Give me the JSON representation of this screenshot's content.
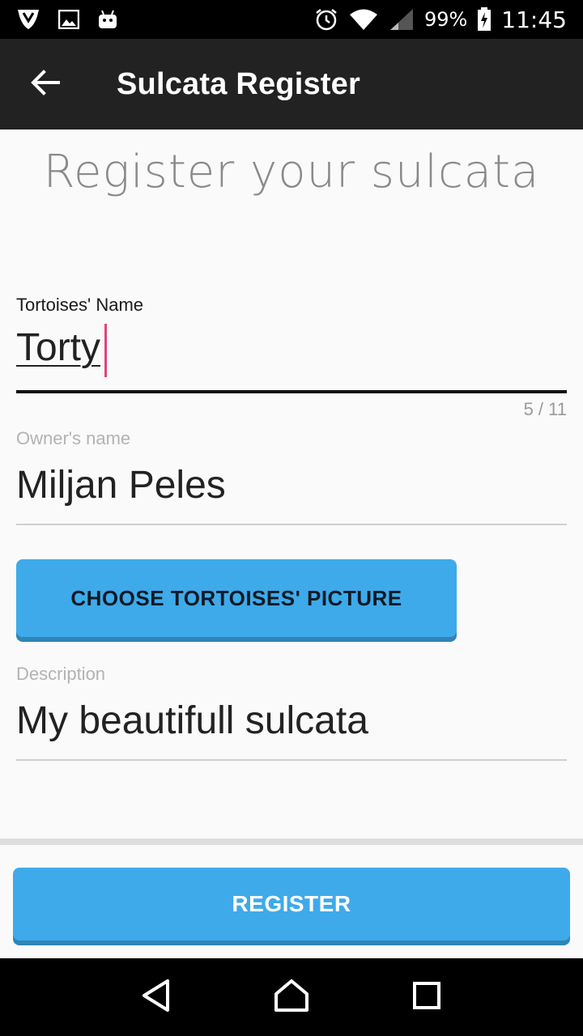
{
  "status_bar": {
    "left_icons": [
      "shield-icon",
      "image-icon",
      "android-icon"
    ],
    "battery_percent": "99%",
    "time": "11:45"
  },
  "app_bar": {
    "title": "Sulcata Register"
  },
  "form": {
    "heading": "Register your sulcata",
    "tortoise_name": {
      "label": "Tortoises' Name",
      "value": "Torty",
      "counter": "5 / 11"
    },
    "owner_name": {
      "label": "Owner's name",
      "value": "Miljan Peles"
    },
    "choose_picture_label": "CHOOSE TORTOISES' PICTURE",
    "description": {
      "label": "Description",
      "value": "My beautifull sulcata"
    }
  },
  "footer": {
    "register_label": "REGISTER"
  },
  "colors": {
    "accent": "#3eaaea",
    "app_bar": "#222222",
    "cursor": "#e0457b"
  }
}
